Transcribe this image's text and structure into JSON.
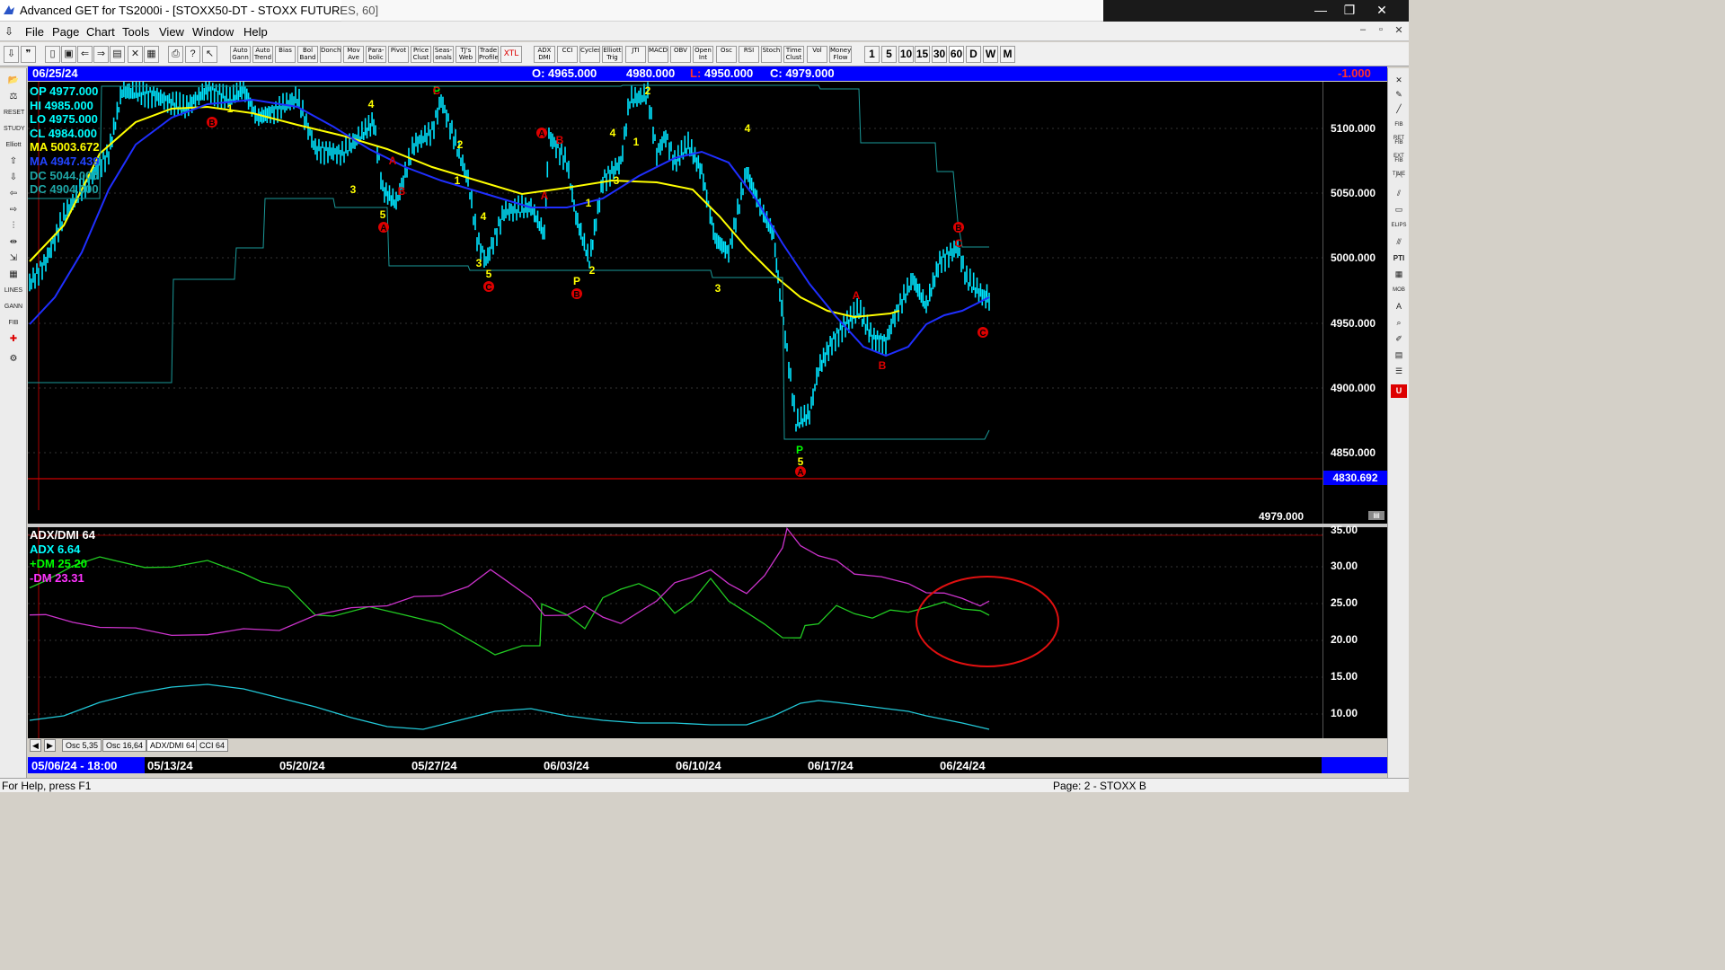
{
  "window": {
    "title": "Advanced GET for TS2000i - [STOXX50-DT - STOXX FUTURES, 60]",
    "min": "—",
    "max": "❐",
    "close": "✕"
  },
  "menu": [
    "File",
    "Page",
    "Chart",
    "Tools",
    "View",
    "Window",
    "Help"
  ],
  "toolbar": {
    "studies": [
      "Auto Gann",
      "Auto Trend",
      "Bias",
      "Bol Band",
      "Donch",
      "Mov Ave",
      "Para-bolic",
      "Pivot",
      "Price Clust",
      "Seas-onals",
      "TJ's Web",
      "Trade Profile",
      "XTL",
      "ADX DMI",
      "CCI",
      "Cycles",
      "Elliott Trig",
      "JTI",
      "MACD",
      "OBV",
      "Open Int",
      "Osc",
      "RSI",
      "Stoch",
      "Time Clust",
      "Vol",
      "Money Flow"
    ],
    "periods": [
      "1",
      "5",
      "10",
      "15",
      "30",
      "60",
      "D",
      "W",
      "M"
    ]
  },
  "infobar": {
    "date": "06/25/24",
    "open": "O: 4965.000",
    "high": "4980.000",
    "low_label": "L:",
    "low": "4950.000",
    "close": "C: 4979.000",
    "change": "-1.000"
  },
  "price_legend": [
    {
      "text": "OP  4977.000",
      "color": "#00ffff"
    },
    {
      "text": "HI   4985.000",
      "color": "#00ffff"
    },
    {
      "text": "LO  4975.000",
      "color": "#00ffff"
    },
    {
      "text": "CL  4984.000",
      "color": "#00ffff"
    },
    {
      "text": "MA  5003.672",
      "color": "#ffff00"
    },
    {
      "text": "MA  4947.439",
      "color": "#2244ff"
    },
    {
      "text": "DC  5044.000",
      "color": "#1fa6a6"
    },
    {
      "text": "DC  4904.000",
      "color": "#1fa6a6"
    }
  ],
  "price_axis": {
    "ticks": [
      "5100.000",
      "5050.000",
      "5000.000",
      "4950.000",
      "4900.000",
      "4850.000"
    ],
    "marker": "4830.692",
    "last": "4979.000"
  },
  "indicator_legend": [
    {
      "text": "ADX/DMI 64",
      "color": "#ffffff"
    },
    {
      "text": "ADX 6.64",
      "color": "#00ffff"
    },
    {
      "text": "+DM 25.20",
      "color": "#00ff00"
    },
    {
      "text": "-DM 23.31",
      "color": "#ff33ff"
    }
  ],
  "indicator_axis": {
    "ticks": [
      "35.00",
      "30.00",
      "25.00",
      "20.00",
      "15.00",
      "10.00"
    ]
  },
  "tabs": [
    "Osc 5,35",
    "Osc 16,64",
    "ADX/DMI 64",
    "CCI 64"
  ],
  "dates": [
    "05/06/24 - 18:00",
    "05/13/24",
    "05/20/24",
    "05/27/24",
    "06/03/24",
    "06/10/24",
    "06/17/24",
    "06/24/24"
  ],
  "wave_labels": [
    "1",
    "B",
    "4",
    "3",
    "A",
    "B",
    "5",
    "A",
    "P",
    "C",
    "2",
    "1",
    "4",
    "3",
    "5",
    "C",
    "A",
    "B",
    "A",
    "1",
    "P",
    "2",
    "B",
    "3",
    "2",
    "1",
    "4",
    "4",
    "3",
    "P",
    "5",
    "A",
    "A",
    "B",
    "B",
    "C",
    "C"
  ],
  "status": {
    "help": "For Help, press F1",
    "page": "Page: 2 - STOXX B"
  },
  "colors": {
    "price_bars": "#00e5ff",
    "ma_fast": "#ffff00",
    "ma_slow": "#1f2fff",
    "donchian": "#1a9a9a",
    "plus_dm": "#22cc22",
    "minus_dm": "#cc33cc",
    "adx": "#22c8d8",
    "highlight_circle": "#e01010",
    "infobar": "#0000ff"
  }
}
